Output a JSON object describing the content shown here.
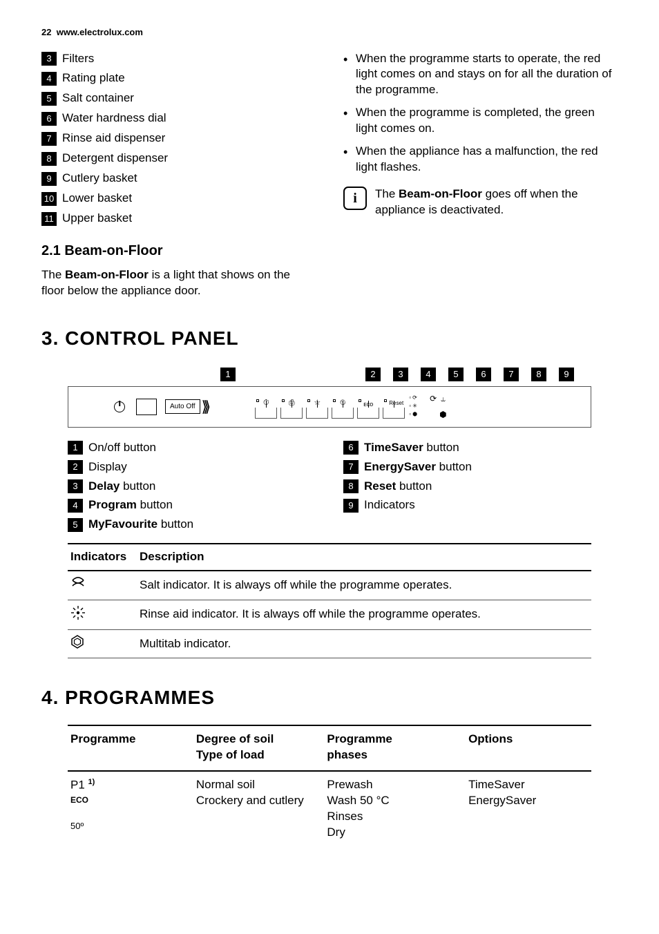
{
  "header": {
    "page_num": "22",
    "url": "www.electrolux.com"
  },
  "parts_list": [
    {
      "n": "3",
      "label": "Filters"
    },
    {
      "n": "4",
      "label": "Rating plate"
    },
    {
      "n": "5",
      "label": "Salt container"
    },
    {
      "n": "6",
      "label": "Water hardness dial"
    },
    {
      "n": "7",
      "label": "Rinse aid dispenser"
    },
    {
      "n": "8",
      "label": "Detergent dispenser"
    },
    {
      "n": "9",
      "label": "Cutlery basket"
    },
    {
      "n": "10",
      "label": "Lower basket"
    },
    {
      "n": "11",
      "label": "Upper basket"
    }
  ],
  "sub21": {
    "num": "2.1",
    "title": "Beam-on-Floor"
  },
  "beam_intro_pre": "The ",
  "beam_intro_bold": "Beam-on-Floor",
  "beam_intro_post": " is a light that shows on the floor below the appliance door.",
  "beam_bullets": [
    "When the programme starts to operate, the red light comes on and stays on for all the duration of the programme.",
    "When the programme is completed, the green light comes on.",
    "When the appliance has a malfunction, the red light flashes."
  ],
  "info_pre": "The ",
  "info_bold": "Beam-on-Floor",
  "info_post": " goes off when the appliance is deactivated.",
  "sec3": {
    "num": "3.",
    "title": "CONTROL PANEL"
  },
  "diagram": {
    "top_left_n": "1",
    "top_right_n": [
      "2",
      "3",
      "4",
      "5",
      "6",
      "7",
      "8",
      "9"
    ],
    "autooff": "Auto Off",
    "reset": "Reset"
  },
  "cp_legend_left": [
    {
      "n": "1",
      "bold": "",
      "label": "On/off button"
    },
    {
      "n": "2",
      "bold": "",
      "label": "Display"
    },
    {
      "n": "3",
      "bold": "Delay",
      "label": " button"
    },
    {
      "n": "4",
      "bold": "Program",
      "label": " button"
    },
    {
      "n": "5",
      "bold": "MyFavourite",
      "label": " button"
    }
  ],
  "cp_legend_right": [
    {
      "n": "6",
      "bold": "TimeSaver",
      "label": " button"
    },
    {
      "n": "7",
      "bold": "EnergySaver",
      "label": " button"
    },
    {
      "n": "8",
      "bold": "Reset",
      "label": " button"
    },
    {
      "n": "9",
      "bold": "",
      "label": "Indicators"
    }
  ],
  "ind_head": {
    "c1": "Indicators",
    "c2": "Description"
  },
  "ind_rows": [
    {
      "icon": "salt",
      "desc": "Salt indicator. It is always off while the programme operates."
    },
    {
      "icon": "rinse",
      "desc": "Rinse aid indicator. It is always off while the programme operates."
    },
    {
      "icon": "multitab",
      "desc": "Multitab indicator."
    }
  ],
  "sec4": {
    "num": "4.",
    "title": "PROGRAMMES"
  },
  "prog_head": {
    "c1": "Programme",
    "c2a": "Degree of soil",
    "c2b": "Type of load",
    "c3a": "Programme",
    "c3b": "phases",
    "c4": "Options"
  },
  "prog_row1": {
    "name_p": "P1",
    "name_sup": "1)",
    "name_eco": "ECO",
    "name_temp": "50º",
    "soil": "Normal soil\nCrockery and cutlery",
    "phases": "Prewash\nWash 50 °C\nRinses\nDry",
    "options": "TimeSaver\nEnergySaver"
  }
}
